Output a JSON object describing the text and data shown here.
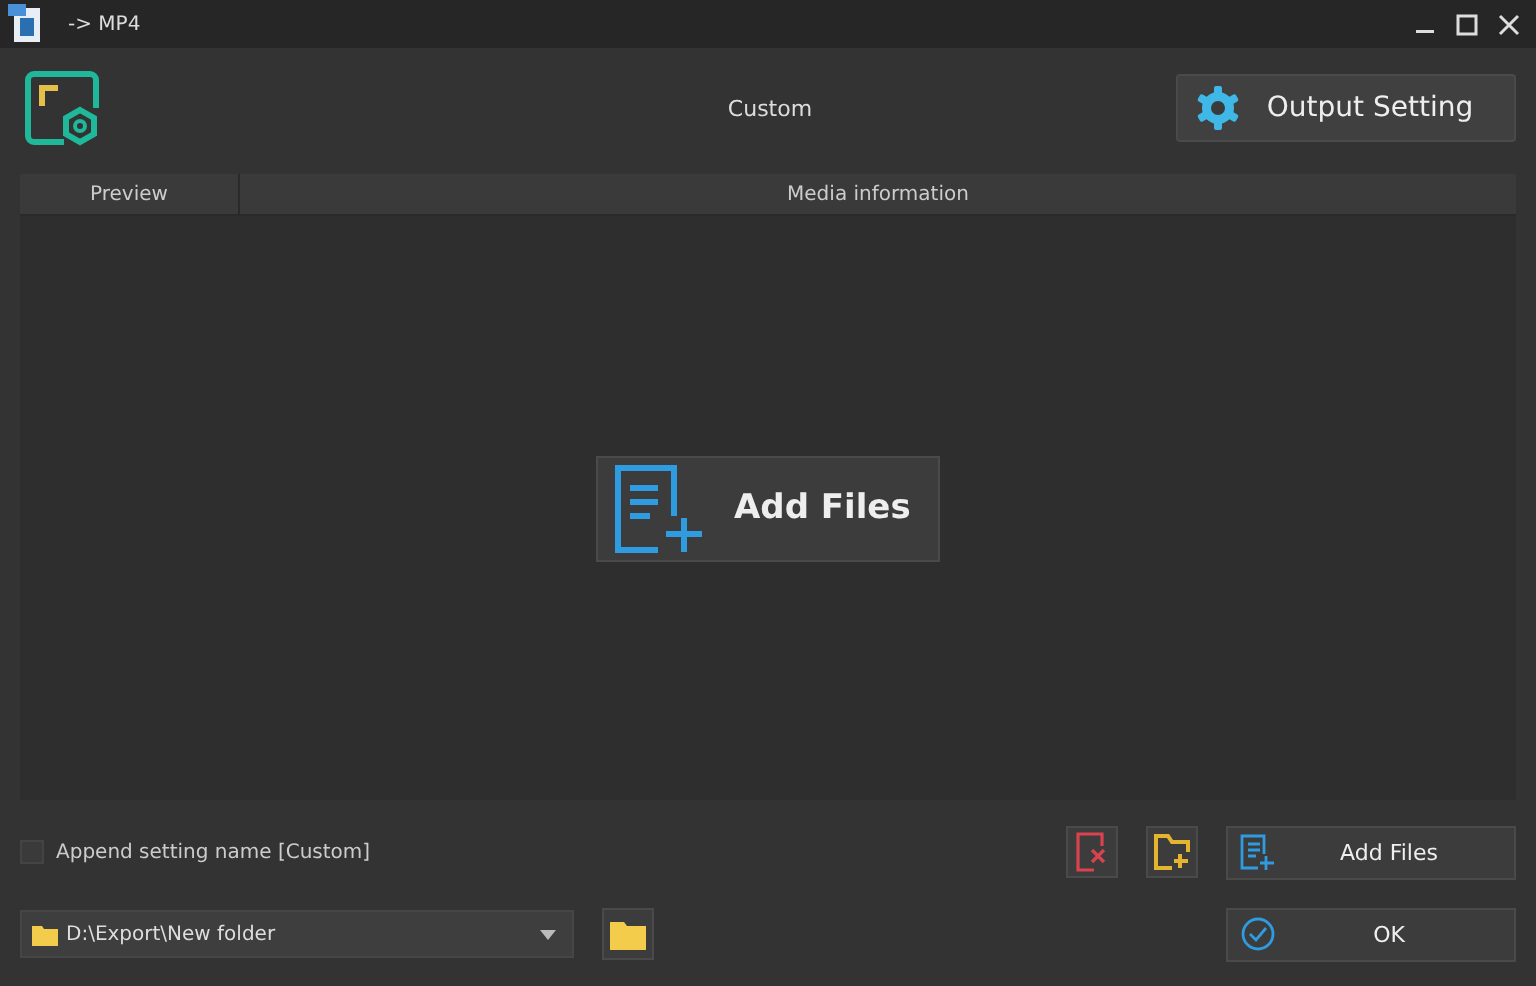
{
  "window": {
    "title": "-> MP4"
  },
  "profile": {
    "name": "Custom"
  },
  "output_setting_button": {
    "label": "Output Setting"
  },
  "table": {
    "columns": [
      "Preview",
      "Media information"
    ]
  },
  "center_button": {
    "label": "Add Files"
  },
  "append_option": {
    "label": "Append setting name [Custom]",
    "checked": false
  },
  "add_files_button": {
    "label": "Add Files"
  },
  "output_folder": {
    "value": "D:\\Export\\New folder"
  },
  "ok_button": {
    "label": "OK"
  }
}
